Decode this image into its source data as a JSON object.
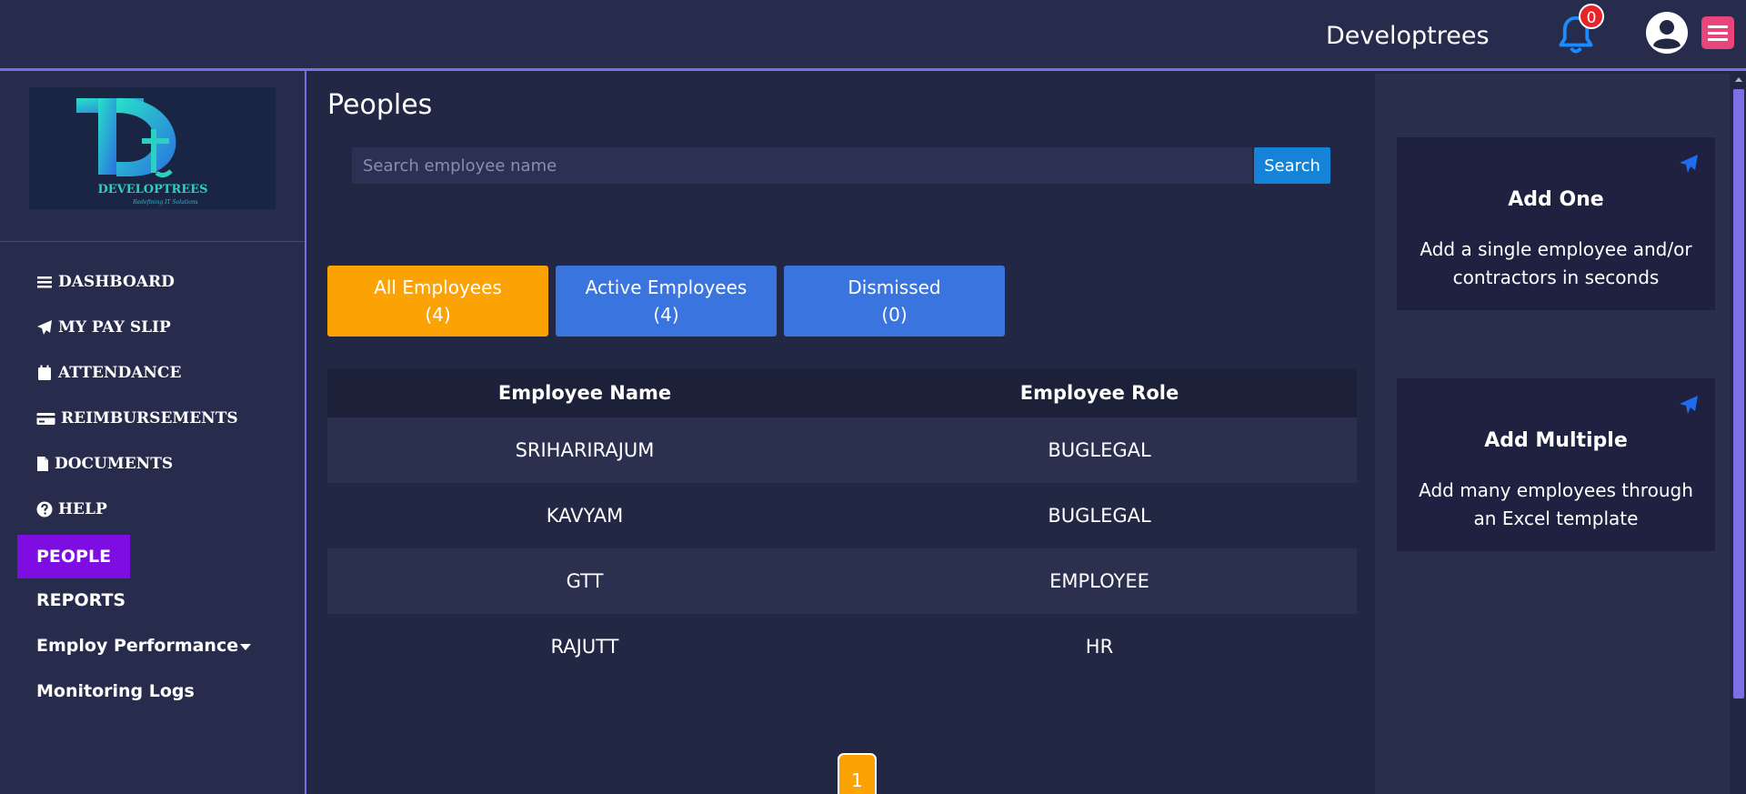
{
  "header": {
    "company_name": "Developtrees",
    "notification_count": "0"
  },
  "logo": {
    "text": "DEVELOPTREES",
    "tagline": "Redefining IT Solutions"
  },
  "sidebar": {
    "items": [
      {
        "label": "DASHBOARD",
        "icon": "bars-icon"
      },
      {
        "label": "MY PAY SLIP",
        "icon": "paper-plane-icon"
      },
      {
        "label": "ATTENDANCE",
        "icon": "calendar-icon"
      },
      {
        "label": "REIMBURSEMENTS",
        "icon": "credit-card-icon"
      },
      {
        "label": "DOCUMENTS",
        "icon": "file-icon"
      },
      {
        "label": "HELP",
        "icon": "question-circle-icon"
      },
      {
        "label": "PEOPLE"
      },
      {
        "label": "REPORTS"
      },
      {
        "label": "Employ Performance"
      },
      {
        "label": "Monitoring Logs"
      }
    ]
  },
  "main": {
    "title": "Peoples",
    "search": {
      "placeholder": "Search employee name",
      "button_label": "Search"
    },
    "filters": [
      {
        "label": "All Employees",
        "count": "(4)",
        "color": "#fba304"
      },
      {
        "label": "Active Employees",
        "count": "(4)",
        "color": "#3a75df"
      },
      {
        "label": "Dismissed",
        "count": "(0)",
        "color": "#3a75df"
      }
    ],
    "table": {
      "headers": [
        "Employee Name",
        "Employee Role"
      ],
      "rows": [
        [
          "SRIHARIRAJUM",
          "BUGLEGAL"
        ],
        [
          "KAVYAM",
          "BUGLEGAL"
        ],
        [
          "GTT",
          "EMPLOYEE"
        ],
        [
          "RAJUTT",
          "HR"
        ]
      ]
    },
    "pagination": {
      "current_page": "1"
    }
  },
  "right_panel": {
    "cards": [
      {
        "title": "Add One",
        "description": "Add a single employee and/or contractors in seconds",
        "icon": "paper-plane-icon"
      },
      {
        "title": "Add Multiple",
        "description": "Add many employees through an Excel template",
        "icon": "paper-plane-icon"
      }
    ]
  },
  "colors": {
    "background": "#222744",
    "accent_purple": "#7d0de0",
    "accent_orange": "#fba304",
    "accent_blue": "#3a75df",
    "border_violet": "#7b6fe6"
  }
}
